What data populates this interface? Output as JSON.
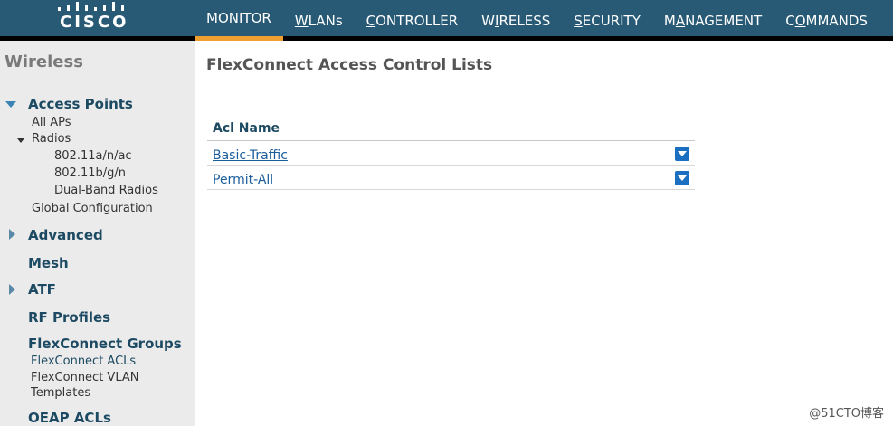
{
  "brand": {
    "logo_text": "CISCO"
  },
  "nav": [
    {
      "pre": "",
      "u": "M",
      "post": "ONITOR",
      "active": true
    },
    {
      "pre": "",
      "u": "W",
      "post": "LANs",
      "active": false
    },
    {
      "pre": "",
      "u": "C",
      "post": "ONTROLLER",
      "active": false
    },
    {
      "pre": "W",
      "u": "I",
      "post": "RELESS",
      "active": false
    },
    {
      "pre": "",
      "u": "S",
      "post": "ECURITY",
      "active": false
    },
    {
      "pre": "M",
      "u": "A",
      "post": "NAGEMENT",
      "active": false
    },
    {
      "pre": "C",
      "u": "O",
      "post": "MMANDS",
      "active": false
    }
  ],
  "sidebar": {
    "title": "Wireless",
    "access_points": "Access Points",
    "all_aps": "All APs",
    "radios": "Radios",
    "radio_a": "802.11a/n/ac",
    "radio_b": "802.11b/g/n",
    "dual_band": "Dual-Band Radios",
    "global_config": "Global Configuration",
    "advanced": "Advanced",
    "mesh": "Mesh",
    "atf": "ATF",
    "rf_profiles": "RF Profiles",
    "flexconnect_groups": "FlexConnect Groups",
    "flexconnect_acls": "FlexConnect ACLs",
    "flexconnect_vlan_line1": "FlexConnect VLAN",
    "flexconnect_vlan_line2": "Templates",
    "oeap_acls": "OEAP ACLs"
  },
  "main": {
    "title": "FlexConnect Access Control Lists",
    "column_header": "Acl Name",
    "rows": [
      {
        "name": "Basic-Traffic"
      },
      {
        "name": "Permit-All"
      }
    ]
  },
  "watermark": "@51CTO博客",
  "colors": {
    "topbar": "#285a75",
    "active_tab": "#f0a030",
    "sidebar_bg": "#ebebeb",
    "link": "#1a5d9c"
  }
}
